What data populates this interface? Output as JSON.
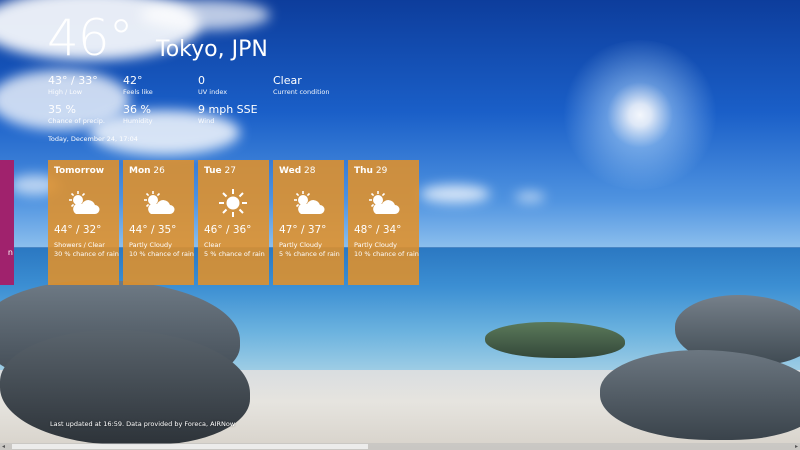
{
  "current": {
    "temperature": "46°",
    "location": "Tokyo, JPN"
  },
  "stats": [
    {
      "value": "43° / 33°",
      "label": "High / Low"
    },
    {
      "value": "42°",
      "label": "Feels like"
    },
    {
      "value": "0",
      "label": "UV index"
    },
    {
      "value": "Clear",
      "label": "Current condition"
    },
    {
      "value": "35 %",
      "label": "Chance of precip."
    },
    {
      "value": "36 %",
      "label": "Humidity"
    },
    {
      "value": "9 mph SSE",
      "label": "Wind"
    }
  ],
  "date_line": "Today, December 24, 17:04",
  "forecast": [
    {
      "day": "Tomorrow",
      "date": "",
      "hilo": "44° / 32°",
      "condition": "Showers / Clear",
      "rain": "30 % chance of rain",
      "icon": "partly-cloudy-icon"
    },
    {
      "day": "Mon",
      "date": "26",
      "hilo": "44° / 35°",
      "condition": "Partly Cloudy",
      "rain": "10 % chance of rain",
      "icon": "partly-cloudy-icon"
    },
    {
      "day": "Tue",
      "date": "27",
      "hilo": "46° / 36°",
      "condition": "Clear",
      "rain": "5 % chance of rain",
      "icon": "sun-icon"
    },
    {
      "day": "Wed",
      "date": "28",
      "hilo": "47° / 37°",
      "condition": "Partly Cloudy",
      "rain": "5 % chance of rain",
      "icon": "partly-cloudy-icon"
    },
    {
      "day": "Thu",
      "date": "29",
      "hilo": "48° / 34°",
      "condition": "Partly Cloudy",
      "rain": "10 % chance of rain",
      "icon": "partly-cloudy-icon"
    }
  ],
  "footer": "Last updated at 16:59. Data provided by Foreca, AIRNow",
  "side_tile_letter": "n",
  "colors": {
    "tile": "#e0912a",
    "side_tile": "#a0226d"
  },
  "scroll": {
    "left_arrow": "◂",
    "right_arrow": "▸"
  }
}
